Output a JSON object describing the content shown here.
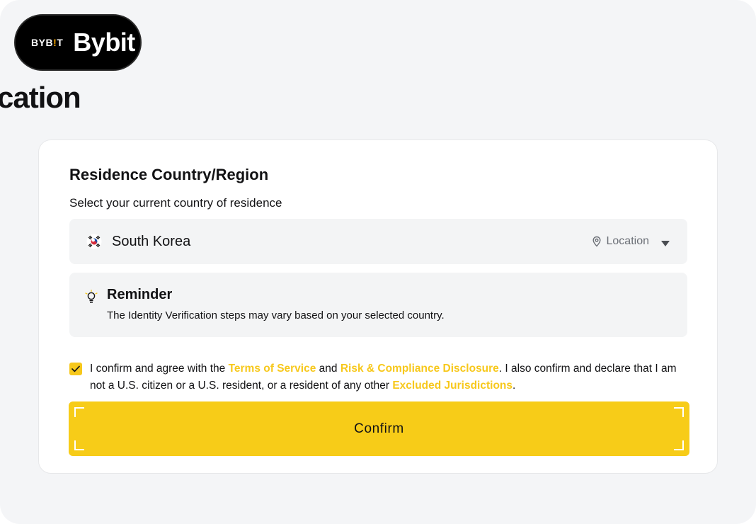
{
  "brand": {
    "mark_left": "BYB",
    "mark_accent": "!",
    "mark_right": "T",
    "name": "Bybit"
  },
  "page": {
    "title": "cation"
  },
  "residence": {
    "title": "Residence Country/Region",
    "subtitle": "Select your current country of residence",
    "selected_country": "South Korea",
    "location_label": "Location",
    "flag_icon": "south-korea-flag-icon"
  },
  "reminder": {
    "title": "Reminder",
    "text": "The Identity Verification steps may vary based on your selected country."
  },
  "agreement": {
    "checked": true,
    "part1": "I confirm and agree with the ",
    "link_terms": "Terms of Service",
    "part2": " and ",
    "link_risk": "Risk & Compliance Disclosure",
    "part3": ". I also confirm and declare that I am not a U.S. citizen or a U.S. resident, or a resident of any other ",
    "link_excluded": "Excluded Jurisdictions",
    "part4": "."
  },
  "actions": {
    "confirm_label": "Confirm"
  },
  "colors": {
    "accent": "#f7cc18",
    "link": "#f7c81c",
    "brand_bg": "#000000",
    "brand_accent": "#f7a600"
  }
}
